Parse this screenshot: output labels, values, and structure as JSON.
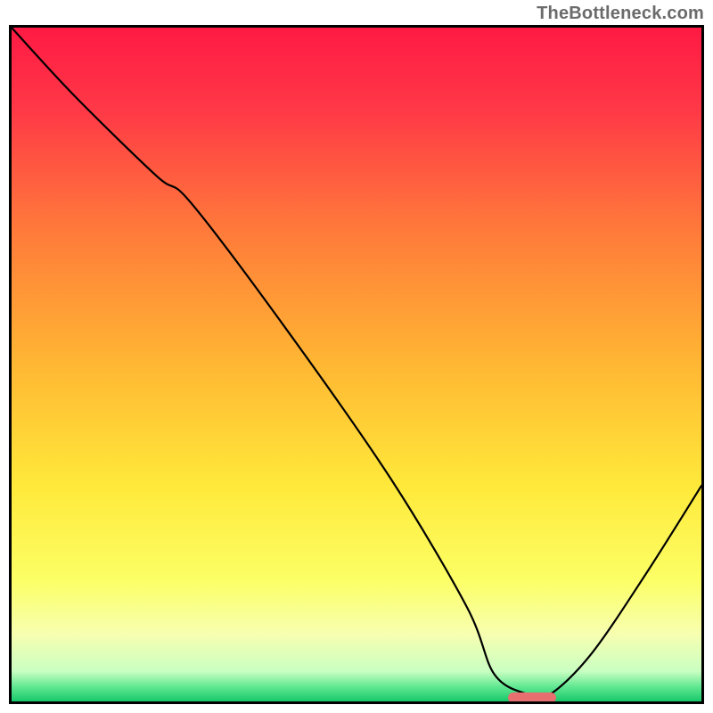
{
  "watermark": "TheBottleneck.com",
  "chart_data": {
    "type": "line",
    "title": "",
    "xlabel": "",
    "ylabel": "",
    "xlim": [
      0,
      100
    ],
    "ylim": [
      0,
      100
    ],
    "grid": false,
    "legend": false,
    "gradient_stops": [
      {
        "pos": 0.0,
        "color": "#ff1a44"
      },
      {
        "pos": 0.12,
        "color": "#ff3847"
      },
      {
        "pos": 0.3,
        "color": "#ff7a3a"
      },
      {
        "pos": 0.5,
        "color": "#ffb733"
      },
      {
        "pos": 0.68,
        "color": "#ffe93a"
      },
      {
        "pos": 0.82,
        "color": "#fcff66"
      },
      {
        "pos": 0.9,
        "color": "#f7ffb0"
      },
      {
        "pos": 0.955,
        "color": "#caffc2"
      },
      {
        "pos": 0.978,
        "color": "#62e892"
      },
      {
        "pos": 1.0,
        "color": "#18c76a"
      }
    ],
    "series": [
      {
        "name": "bottleneck-curve",
        "x": [
          0,
          9,
          21,
          26,
          40,
          55,
          66,
          70,
          75,
          78,
          84,
          92,
          100
        ],
        "y": [
          100,
          90,
          78,
          74,
          55,
          33,
          14,
          4,
          1,
          1,
          7,
          19,
          32
        ]
      }
    ],
    "marker": {
      "name": "optimal-range",
      "x_start": 72,
      "x_end": 79,
      "y": 0.5,
      "color": "#e76f6f"
    }
  }
}
